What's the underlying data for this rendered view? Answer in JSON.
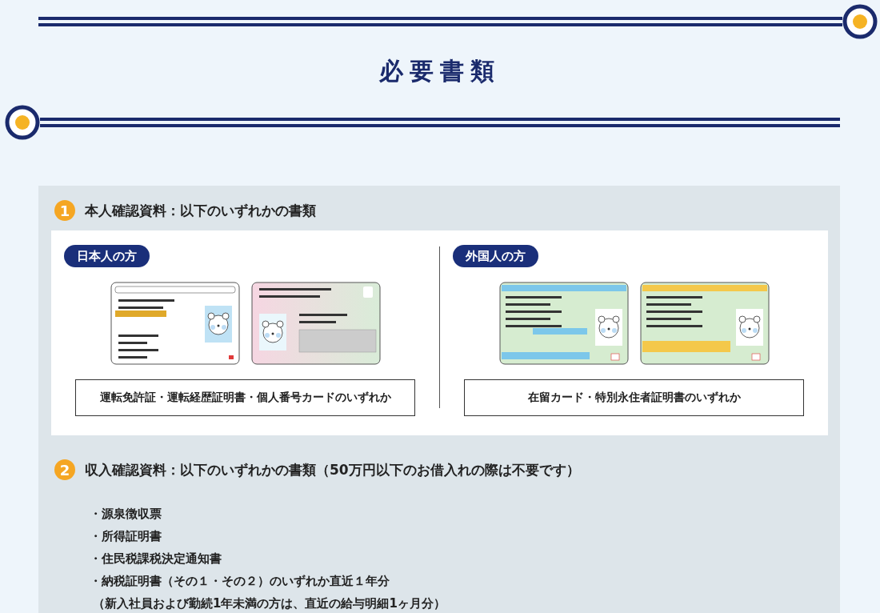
{
  "title": "必要書類",
  "sections": [
    {
      "kind": "cards",
      "number": "1",
      "heading": "本人確認資料：以下のいずれかの書類",
      "groups": [
        {
          "label": "日本人の方",
          "cards": [
            {
              "kind": "license"
            },
            {
              "kind": "mynumber"
            }
          ],
          "caption": "運転免許証・運転経歴証明書・個人番号カードのいずれか"
        },
        {
          "label": "外国人の方",
          "cards": [
            {
              "kind": "residence"
            },
            {
              "kind": "permanent"
            }
          ],
          "caption": "在留カード・特別永住者証明書のいずれか"
        }
      ]
    },
    {
      "kind": "list",
      "number": "2",
      "heading": "収入確認資料：以下のいずれかの書類（50万円以下のお借入れの際は不要です）",
      "items": [
        {
          "kind": "bullet",
          "text": "・源泉徴収票"
        },
        {
          "kind": "bullet",
          "text": "・所得証明書"
        },
        {
          "kind": "bullet",
          "text": "・住民税課税決定通知書"
        },
        {
          "kind": "bullet",
          "text": "・納税証明書（その１・その２）のいずれか直近１年分"
        },
        {
          "kind": "note",
          "text": "（新入社員および勤続1年未満の方は、直近の給与明細1ヶ月分）"
        }
      ]
    }
  ]
}
